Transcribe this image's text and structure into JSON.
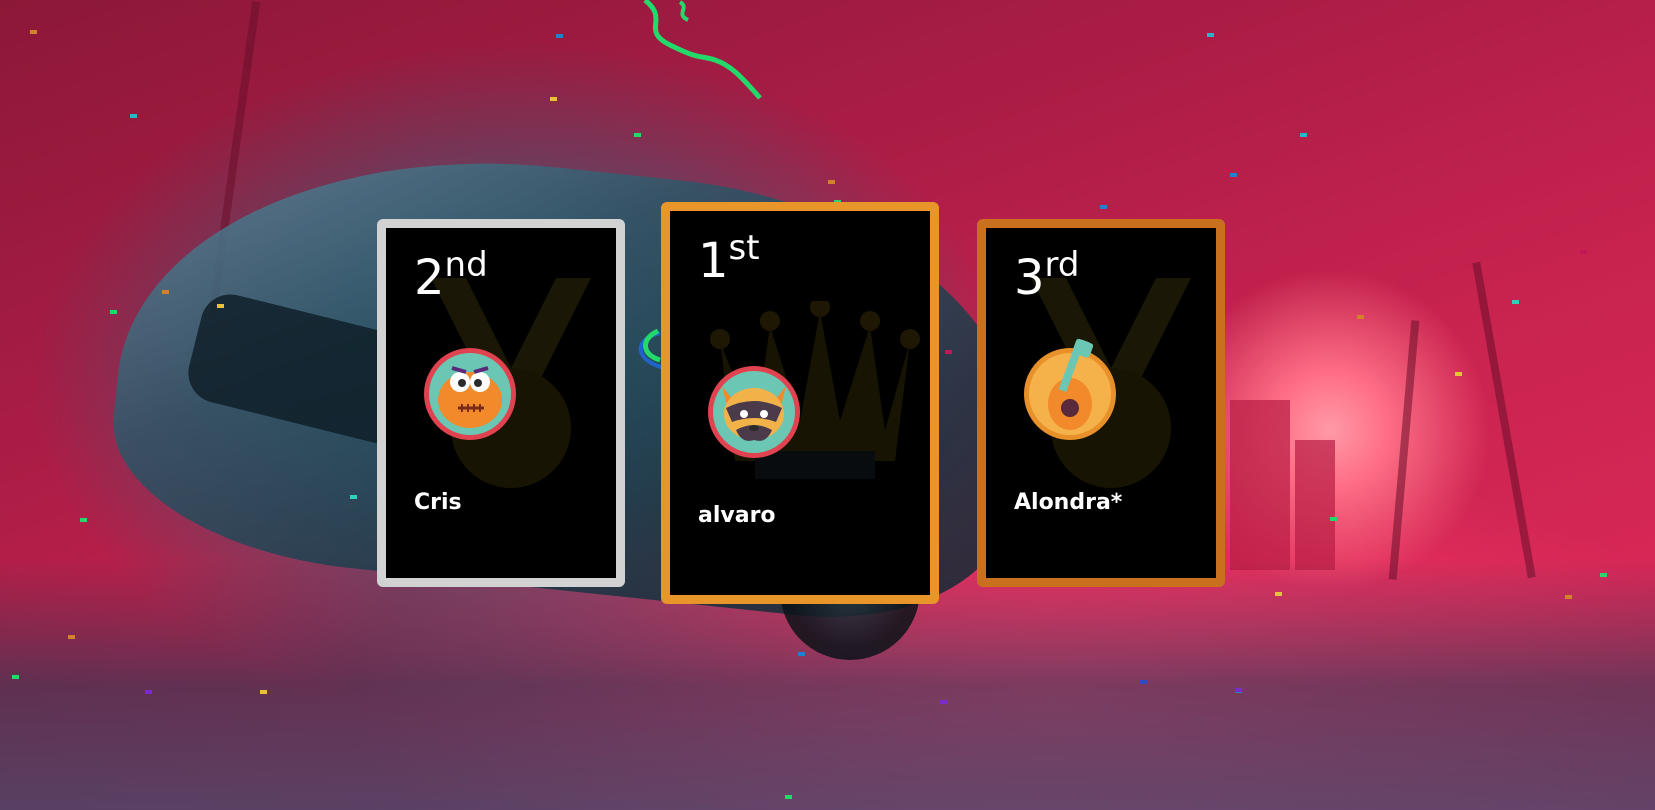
{
  "podium": {
    "second": {
      "place_number": "2",
      "place_suffix": "nd",
      "player_name": "Cris",
      "avatar_icon": "orange-monster-avatar-icon",
      "border_color": "#d2d2d2"
    },
    "first": {
      "place_number": "1",
      "place_suffix": "st",
      "player_name": "alvaro",
      "avatar_icon": "raccoon-avatar-icon",
      "border_color": "#e8962a"
    },
    "third": {
      "place_number": "3",
      "place_suffix": "rd",
      "player_name": "Alondra*",
      "avatar_icon": "guitar-avatar-icon",
      "border_color": "#c9701f"
    }
  },
  "colors": {
    "background_accent": "#c8234f",
    "card_background": "#000000",
    "avatar_ring": "#e0434f",
    "avatar_fill": "#6bc6b4"
  }
}
